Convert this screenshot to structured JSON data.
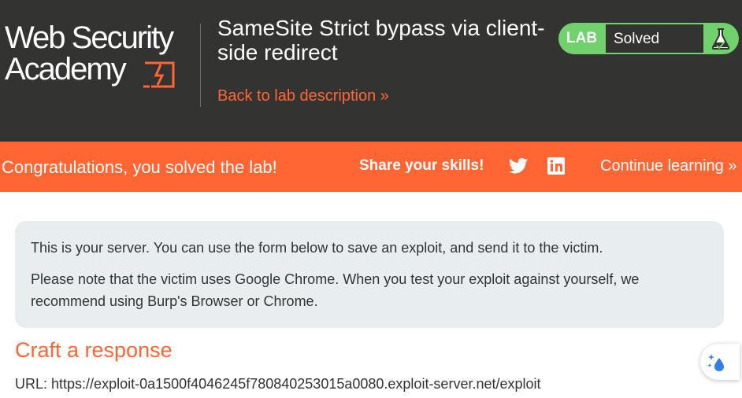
{
  "header": {
    "logo_line1": "Web Security",
    "logo_line2": "Academy",
    "lab_title": "SameSite Strict bypass via client-side redirect",
    "back_link": "Back to lab description",
    "back_link_chevron": "»",
    "status_badge": {
      "label": "LAB",
      "value": "Solved",
      "icon": "flask-icon",
      "color": "#70d16d"
    }
  },
  "banner": {
    "message": "Congratulations, you solved the lab!",
    "share_label": "Share your skills!",
    "social_icons": [
      "twitter-icon",
      "linkedin-icon"
    ],
    "continue_label": "Continue learning",
    "continue_chevron": "»",
    "color": "#ff6633"
  },
  "info": {
    "paragraph1": "This is your server. You can use the form below to save an exploit, and send it to the victim.",
    "paragraph2": "Please note that the victim uses Google Chrome. When you test your exploit against yourself, we recommend using Burp's Browser or Chrome."
  },
  "form": {
    "heading": "Craft a response",
    "url_label": "URL:",
    "url_value": "https://exploit-0a1500f4046245f780840253015a0080.exploit-server.net/exploit"
  },
  "floating_button": {
    "icon": "sparkle-drop-icon"
  }
}
